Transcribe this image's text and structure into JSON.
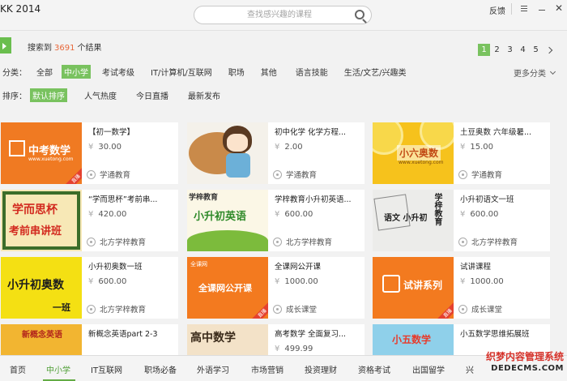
{
  "window": {
    "title": "KK 2014",
    "feedback_label": "反馈"
  },
  "search": {
    "placeholder": "查找感兴趣的课程"
  },
  "results": {
    "prefix": "搜索到",
    "count": "3691",
    "suffix": "个结果"
  },
  "pagination": {
    "pages": [
      "1",
      "2",
      "3",
      "4",
      "5"
    ],
    "current": "1"
  },
  "filters": {
    "category_label": "分类：",
    "categories": [
      "全部",
      "中小学",
      "考试考级",
      "IT/计算机/互联网",
      "职场",
      "其他",
      "语言技能",
      "生活/文艺/兴趣类"
    ],
    "active_category": "中小学",
    "more_label": "更多分类",
    "sort_label": "排序：",
    "sorts": [
      "默认排序",
      "人气热度",
      "今日直播",
      "最新发布"
    ],
    "active_sort": "默认排序"
  },
  "courses": [
    {
      "title": "【初一数学】",
      "price": "30.00",
      "org": "学通教育",
      "thumb_text": "中考数学",
      "thumb_sub": "www.xuetong.com",
      "badge": "直播"
    },
    {
      "title": "初中化学 化学方程...",
      "price": "2.00",
      "org": "学通教育",
      "thumb_text": "",
      "thumb_sub": "",
      "badge": ""
    },
    {
      "title": "土豆奥数 六年级暑...",
      "price": "15.00",
      "org": "学通教育",
      "thumb_text": "小六奥数",
      "thumb_sub": "www.xuetong.com",
      "badge": ""
    },
    {
      "title": "“学而思杯”考前串...",
      "price": "420.00",
      "org": "北方学梓教育",
      "thumb_text": "学而思杯",
      "thumb_sub": "考前串讲班",
      "badge": ""
    },
    {
      "title": "学梓教育小升初英语...",
      "price": "600.00",
      "org": "北方学梓教育",
      "thumb_text": "小升初英语",
      "thumb_sub": "学梓教育",
      "badge": ""
    },
    {
      "title": "小升初语文一班",
      "price": "600.00",
      "org": "北方学梓教育",
      "thumb_text": "语文 小升初",
      "thumb_sub": "学梓教育",
      "badge": ""
    },
    {
      "title": "小升初奥数一班",
      "price": "600.00",
      "org": "北方学梓教育",
      "thumb_text": "小升初奥数",
      "thumb_sub": "一班",
      "badge": ""
    },
    {
      "title": "全课网公开课",
      "price": "1000.00",
      "org": "成长课堂",
      "thumb_text": "全课网公开课",
      "thumb_sub": "全课网",
      "badge": "直播"
    },
    {
      "title": "试讲课程",
      "price": "1000.00",
      "org": "成长课堂",
      "thumb_text": "试讲系列",
      "thumb_sub": "",
      "badge": "直播"
    },
    {
      "title": "新概念英语part 2-3",
      "price": "",
      "org": "",
      "thumb_text": "新概念英语",
      "thumb_sub": "",
      "badge": ""
    },
    {
      "title": "高考数学 全面复习...",
      "price": "499.99",
      "org": "",
      "thumb_text": "高中数学",
      "thumb_sub": "",
      "badge": ""
    },
    {
      "title": "小五数学思维拓展班",
      "price": "",
      "org": "",
      "thumb_text": "小五数学",
      "thumb_sub": "",
      "badge": ""
    }
  ],
  "bottom_nav": {
    "items": [
      "首页",
      "中小学",
      "IT互联网",
      "职场必备",
      "外语学习",
      "市场营销",
      "投资理财",
      "资格考试",
      "出国留学",
      "兴"
    ],
    "active": "中小学"
  },
  "watermark": {
    "line1": "织梦内容管理系统",
    "line2": "DEDECMS.COM"
  },
  "colors": {
    "accent_green": "#79c25f",
    "result_orange": "#e8683a",
    "badge_red": "#e5412f"
  }
}
